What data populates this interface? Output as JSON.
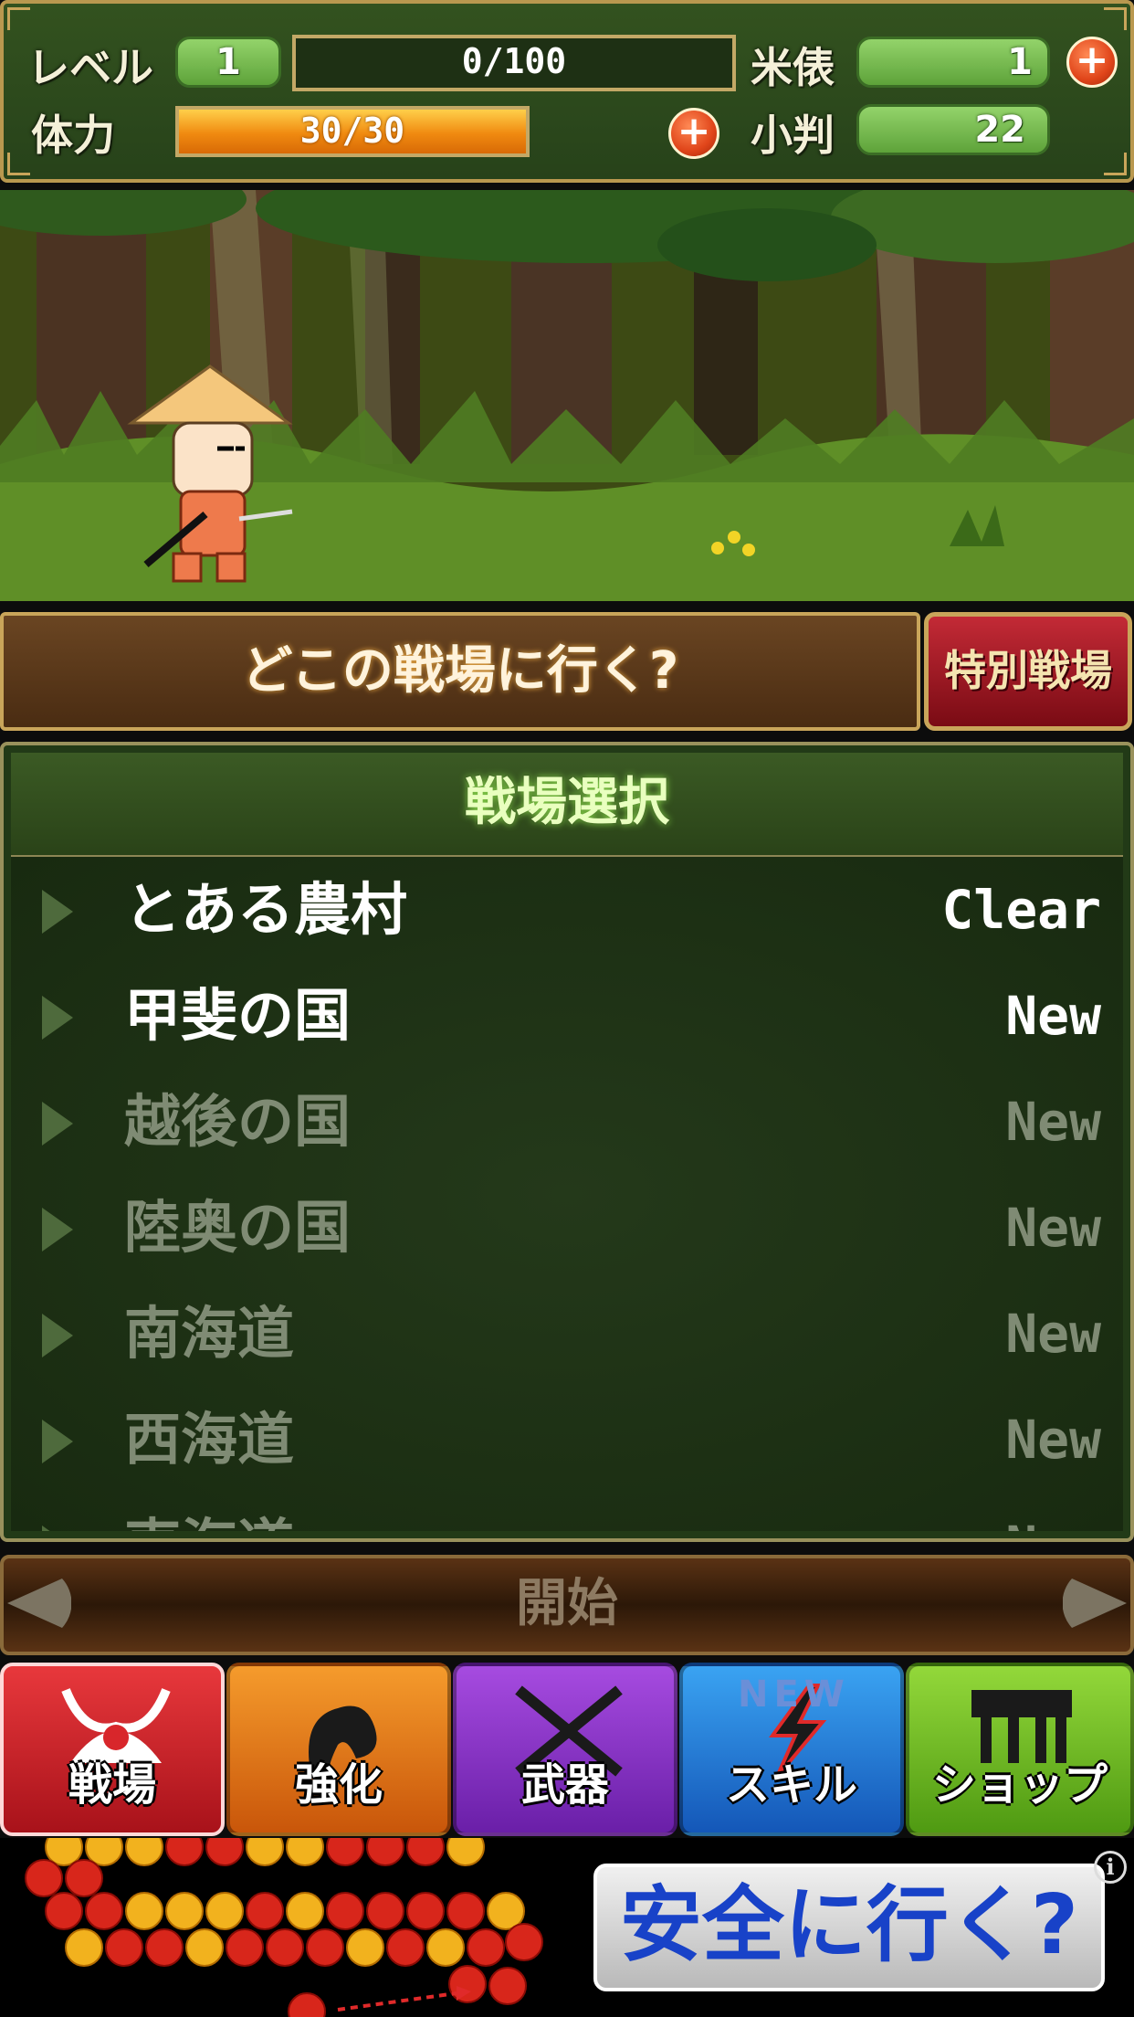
{
  "status": {
    "level_label": "レベル",
    "level_value": "1",
    "exp_text": "0/100",
    "stamina_label": "体力",
    "stamina_text": "30/30",
    "stamina_fraction": 1.0,
    "rice_label": "米俵",
    "rice_value": "1",
    "koban_label": "小判",
    "koban_value": "22",
    "plus_symbol": "+"
  },
  "destination": {
    "prompt": "どこの戦場に行く?",
    "special_button": "特別戦場"
  },
  "stage_panel": {
    "title": "戦場選択",
    "stages": [
      {
        "name": "とある農村",
        "status": "Clear",
        "unlocked": true
      },
      {
        "name": "甲斐の国",
        "status": "New",
        "unlocked": true
      },
      {
        "name": "越後の国",
        "status": "New",
        "unlocked": false
      },
      {
        "name": "陸奥の国",
        "status": "New",
        "unlocked": false
      },
      {
        "name": "南海道",
        "status": "New",
        "unlocked": false
      },
      {
        "name": "西海道",
        "status": "New",
        "unlocked": false
      },
      {
        "name": "東海道",
        "status": "New",
        "unlocked": false
      }
    ]
  },
  "start_button": "開始",
  "nav": {
    "items": [
      {
        "label": "戦場",
        "icon": "kabuto-helmet-icon",
        "color": "#d8262b",
        "active": true
      },
      {
        "label": "強化",
        "icon": "muscle-arm-icon",
        "color": "#f07a10",
        "active": false
      },
      {
        "label": "武器",
        "icon": "crossed-swords-icon",
        "color": "#8a2fc8",
        "active": false
      },
      {
        "label": "スキル",
        "icon": "lightning-icon",
        "color": "#1f7fe0",
        "active": false,
        "badge": "NEW"
      },
      {
        "label": "ショップ",
        "icon": "shop-icon",
        "color": "#7cc21a",
        "active": false
      }
    ]
  },
  "ad": {
    "text": "安全に行く?",
    "info_symbol": "i"
  }
}
